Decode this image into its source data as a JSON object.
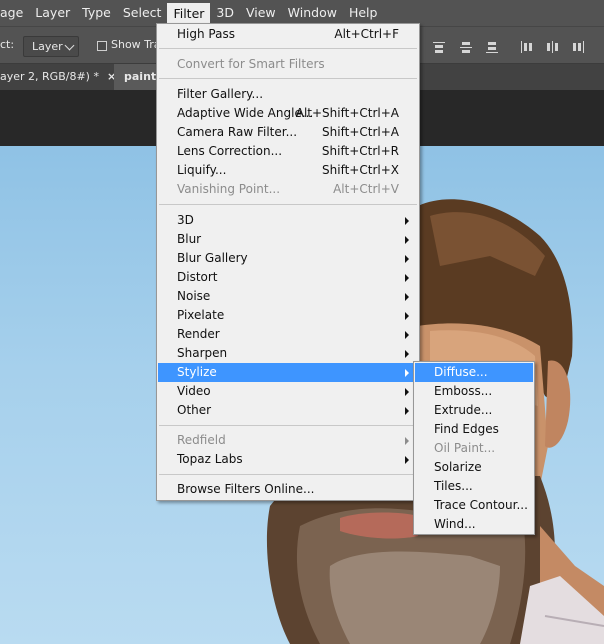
{
  "menubar": {
    "items": [
      {
        "label": "age"
      },
      {
        "label": "Layer"
      },
      {
        "label": "Type"
      },
      {
        "label": "Select"
      },
      {
        "label": "Filter",
        "active": true
      },
      {
        "label": "3D"
      },
      {
        "label": "View"
      },
      {
        "label": "Window"
      },
      {
        "label": "Help"
      }
    ]
  },
  "options": {
    "label": "ct:",
    "sample_select": "Layer",
    "show_transform": "Show Tran"
  },
  "tabs": [
    {
      "label": "ayer 2, RGB/8#) *",
      "close": "×"
    },
    {
      "label": "painti"
    }
  ],
  "filter_menu": {
    "items": [
      {
        "label": "High Pass",
        "shortcut": "Alt+Ctrl+F"
      },
      {
        "label": "Convert for Smart Filters",
        "disabled": true
      },
      {
        "label": "Filter Gallery..."
      },
      {
        "label": "Adaptive Wide Angle...",
        "shortcut": "Alt+Shift+Ctrl+A"
      },
      {
        "label": "Camera Raw Filter...",
        "shortcut": "Shift+Ctrl+A"
      },
      {
        "label": "Lens Correction...",
        "shortcut": "Shift+Ctrl+R"
      },
      {
        "label": "Liquify...",
        "shortcut": "Shift+Ctrl+X"
      },
      {
        "label": "Vanishing Point...",
        "shortcut": "Alt+Ctrl+V",
        "disabled": true
      },
      {
        "label": "3D",
        "submenu": true
      },
      {
        "label": "Blur",
        "submenu": true
      },
      {
        "label": "Blur Gallery",
        "submenu": true
      },
      {
        "label": "Distort",
        "submenu": true
      },
      {
        "label": "Noise",
        "submenu": true
      },
      {
        "label": "Pixelate",
        "submenu": true
      },
      {
        "label": "Render",
        "submenu": true
      },
      {
        "label": "Sharpen",
        "submenu": true
      },
      {
        "label": "Stylize",
        "submenu": true,
        "highlighted": true
      },
      {
        "label": "Video",
        "submenu": true
      },
      {
        "label": "Other",
        "submenu": true
      },
      {
        "label": "Redfield",
        "submenu": true,
        "disabled": true
      },
      {
        "label": "Topaz Labs",
        "submenu": true
      },
      {
        "label": "Browse Filters Online..."
      }
    ]
  },
  "stylize_submenu": {
    "items": [
      {
        "label": "Diffuse...",
        "highlighted": true
      },
      {
        "label": "Emboss..."
      },
      {
        "label": "Extrude..."
      },
      {
        "label": "Find Edges"
      },
      {
        "label": "Oil Paint...",
        "disabled": true
      },
      {
        "label": "Solarize"
      },
      {
        "label": "Tiles..."
      },
      {
        "label": "Trace Contour..."
      },
      {
        "label": "Wind..."
      }
    ]
  },
  "colors": {
    "menu_highlight": "#3e95ff",
    "menubar_bg": "#535353",
    "menu_bg": "#f0f0f0",
    "sky": "#a6d0ec"
  }
}
